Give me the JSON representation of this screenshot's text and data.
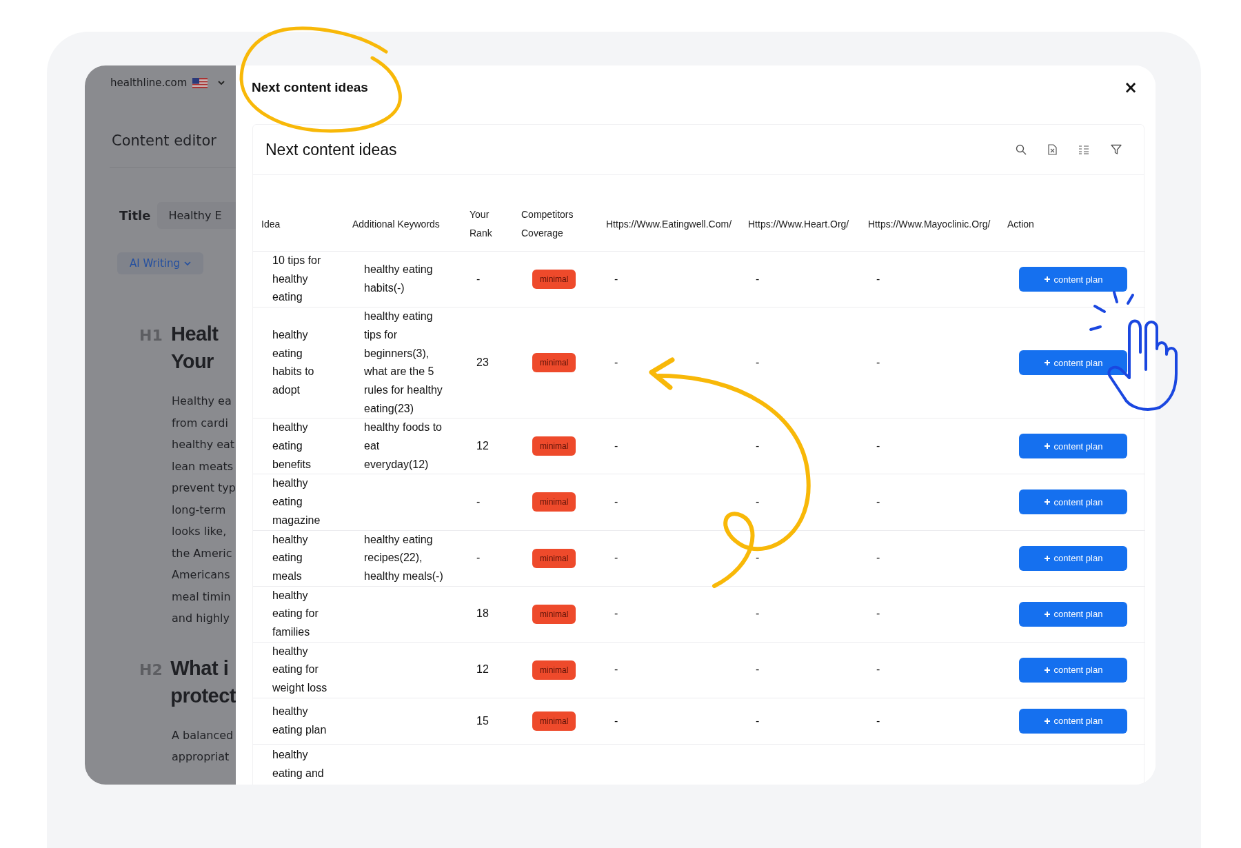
{
  "editor": {
    "site": "healthline.com",
    "page_title": "Content editor",
    "title_label": "Title",
    "title_value": "Healthy E",
    "ai_button": "AI Writing",
    "sections": [
      {
        "kind": "heading",
        "tag": "H1",
        "lines": [
          "Healt",
          "Your"
        ]
      },
      {
        "kind": "paragraph",
        "lines": [
          "Healthy ea",
          "from cardi",
          "healthy eat",
          "lean meats",
          "prevent typ",
          "long-term",
          "looks like,",
          "the Americ",
          "Americans",
          "meal timin",
          "and highly"
        ]
      },
      {
        "kind": "heading",
        "tag": "H2",
        "lines": [
          "What i",
          "protect"
        ]
      },
      {
        "kind": "paragraph",
        "lines": [
          "A balanced",
          "appropriat"
        ]
      }
    ]
  },
  "modal": {
    "title": "Next content ideas",
    "close": "×"
  },
  "panel": {
    "title": "Next content ideas",
    "table": {
      "columns": [
        {
          "label": "Idea"
        },
        {
          "label": "Additional Keywords"
        },
        {
          "label": "Your Rank"
        },
        {
          "label": "Competitors Coverage"
        },
        {
          "label": "Https://Www.Eatingwell.Com/"
        },
        {
          "label": "Https://Www.Heart.Org/"
        },
        {
          "label": "Https://Www.Mayoclinic.Org/"
        },
        {
          "label": "Action"
        }
      ],
      "rows": [
        {
          "idea": "10 tips for healthy eating",
          "keywords": "healthy eating habits(-)",
          "rank": "-",
          "coverage": "minimal",
          "eatingwell": "-",
          "heart": "-",
          "mayoclinic": "-",
          "action": "content plan"
        },
        {
          "idea": "healthy eating habits to adopt",
          "keywords": "healthy eating tips for beginners(3), what are the 5 rules for healthy eating(23)",
          "rank": "23",
          "coverage": "minimal",
          "eatingwell": "-",
          "heart": "-",
          "mayoclinic": "-",
          "action": "content plan"
        },
        {
          "idea": "healthy eating benefits",
          "keywords": "healthy foods to eat everyday(12)",
          "rank": "12",
          "coverage": "minimal",
          "eatingwell": "-",
          "heart": "-",
          "mayoclinic": "-",
          "action": "content plan"
        },
        {
          "idea": "healthy eating magazine",
          "rank": "-",
          "coverage": "minimal",
          "eatingwell": "-",
          "heart": "-",
          "mayoclinic": "-",
          "action": "content plan"
        },
        {
          "idea": "healthy eating meals",
          "keywords": "healthy eating recipes(22), healthy meals(-)",
          "rank": "-",
          "coverage": "minimal",
          "eatingwell": "-",
          "heart": "-",
          "mayoclinic": "-",
          "action": "content plan"
        },
        {
          "idea": "healthy eating for families",
          "rank": "18",
          "coverage": "minimal",
          "eatingwell": "-",
          "heart": "-",
          "mayoclinic": "-",
          "action": "content plan"
        },
        {
          "idea": "healthy eating for weight loss",
          "rank": "12",
          "coverage": "minimal",
          "eatingwell": "-",
          "heart": "-",
          "mayoclinic": "-",
          "action": "content plan"
        },
        {
          "idea": "healthy eating plan",
          "rank": "15",
          "coverage": "minimal",
          "eatingwell": "-",
          "heart": "-",
          "mayoclinic": "-",
          "action": "content plan"
        },
        {
          "idea": "healthy eating and"
        }
      ]
    }
  }
}
